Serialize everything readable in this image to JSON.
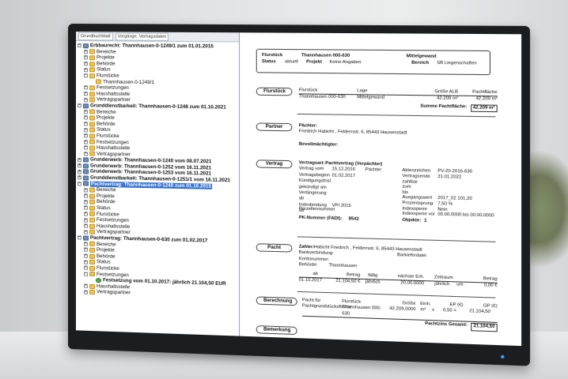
{
  "tree": {
    "toolbar": [
      "Grundbuchblatt",
      "Vorgänge, Vertragsdaten"
    ],
    "items": [
      {
        "level": 1,
        "icon": "root",
        "exp": "−",
        "bold": true,
        "label": "Erbbaurecht: Thannhausen-0-1249/1 zum 01.01.2015"
      },
      {
        "level": 2,
        "icon": "folder",
        "exp": "+",
        "label": "Bereiche"
      },
      {
        "level": 2,
        "icon": "folder",
        "exp": "+",
        "label": "Projekte"
      },
      {
        "level": 2,
        "icon": "folder",
        "exp": "+",
        "label": "Behörde"
      },
      {
        "level": 2,
        "icon": "folder",
        "exp": "+",
        "label": "Status"
      },
      {
        "level": 2,
        "icon": "folder",
        "exp": "−",
        "label": "Flurstücke"
      },
      {
        "level": 3,
        "icon": "folder",
        "exp": "",
        "label": "Thannhausen-0-1249/1"
      },
      {
        "level": 2,
        "icon": "folder",
        "exp": "+",
        "label": "Festsetzungen"
      },
      {
        "level": 2,
        "icon": "folder",
        "exp": "+",
        "label": "Haushaltsstelle"
      },
      {
        "level": 2,
        "icon": "folder",
        "exp": "+",
        "label": "Vertragspartner"
      },
      {
        "level": 1,
        "icon": "root",
        "exp": "−",
        "bold": true,
        "label": "Grunddienstbarkeit: Thannhausen-0-1248 zum 01.10.2021"
      },
      {
        "level": 2,
        "icon": "folder",
        "exp": "+",
        "label": "Bereiche"
      },
      {
        "level": 2,
        "icon": "folder",
        "exp": "+",
        "label": "Projekte"
      },
      {
        "level": 2,
        "icon": "folder",
        "exp": "+",
        "label": "Behörde"
      },
      {
        "level": 2,
        "icon": "folder",
        "exp": "+",
        "label": "Status"
      },
      {
        "level": 2,
        "icon": "folder",
        "exp": "+",
        "label": "Flurstücke"
      },
      {
        "level": 2,
        "icon": "folder",
        "exp": "+",
        "label": "Festsetzungen"
      },
      {
        "level": 2,
        "icon": "folder",
        "exp": "+",
        "label": "Haushaltsstelle"
      },
      {
        "level": 2,
        "icon": "folder",
        "exp": "+",
        "label": "Vertragspartner"
      },
      {
        "level": 1,
        "icon": "root",
        "exp": "+",
        "bold": true,
        "label": "Grunderwerb: Thannhausen-0-1240 vom 08.07.2021"
      },
      {
        "level": 1,
        "icon": "root",
        "exp": "+",
        "bold": true,
        "label": "Grunderwerb: Thannhausen-0-1252 vom 16.11.2021"
      },
      {
        "level": 1,
        "icon": "root",
        "exp": "+",
        "bold": true,
        "label": "Grunderwerb: Thannhausen-0-1253 vom 16.11.2021"
      },
      {
        "level": 1,
        "icon": "root",
        "exp": "+",
        "bold": true,
        "label": "Grunddienstbarkeit: Thannhausen-0-1251/1 vom 16.11.2021"
      },
      {
        "level": 1,
        "icon": "root",
        "exp": "−",
        "bold": true,
        "selected": true,
        "label": "Pachtvertrag: Thannhausen-0-1240 zum 01.10.2015"
      },
      {
        "level": 2,
        "icon": "folder",
        "exp": "+",
        "label": "Bereiche"
      },
      {
        "level": 2,
        "icon": "folder",
        "exp": "+",
        "label": "Projekte"
      },
      {
        "level": 2,
        "icon": "folder",
        "exp": "+",
        "label": "Behörde"
      },
      {
        "level": 2,
        "icon": "folder",
        "exp": "+",
        "label": "Status"
      },
      {
        "level": 2,
        "icon": "folder",
        "exp": "+",
        "label": "Flurstücke"
      },
      {
        "level": 2,
        "icon": "folder",
        "exp": "+",
        "label": "Festsetzungen"
      },
      {
        "level": 2,
        "icon": "folder",
        "exp": "+",
        "label": "Haushaltsstelle"
      },
      {
        "level": 2,
        "icon": "folder",
        "exp": "+",
        "label": "Vertragspartner"
      },
      {
        "level": 1,
        "icon": "root",
        "exp": "−",
        "bold": true,
        "label": "Pachtvertrag: Thannhausen-0-630 zum 01.02.2017"
      },
      {
        "level": 2,
        "icon": "folder",
        "exp": "+",
        "label": "Bereiche"
      },
      {
        "level": 2,
        "icon": "folder",
        "exp": "+",
        "label": "Projekte"
      },
      {
        "level": 2,
        "icon": "folder",
        "exp": "+",
        "label": "Behörde"
      },
      {
        "level": 2,
        "icon": "folder",
        "exp": "+",
        "label": "Status"
      },
      {
        "level": 2,
        "icon": "folder",
        "exp": "+",
        "label": "Flurstücke"
      },
      {
        "level": 2,
        "icon": "folder",
        "exp": "−",
        "label": "Festsetzungen"
      },
      {
        "level": 3,
        "icon": "green",
        "exp": "",
        "bold": true,
        "label": "Festsetzung vom 01.10.2017: jährlich 21.104,50 EUR"
      },
      {
        "level": 2,
        "icon": "folder",
        "exp": "+",
        "label": "Haushaltsstelle"
      },
      {
        "level": 2,
        "icon": "folder",
        "exp": "+",
        "label": "Vertragspartner"
      }
    ]
  },
  "header": {
    "flurstueck_label": "Flurstück",
    "flurstueck_value": "Thannhausen 000-630",
    "lage_value": "Mittelgewand",
    "status_label": "Status",
    "status_value": "aktuell",
    "projekt_label": "Projekt",
    "projekt_value": "Keine Angaben",
    "bereich_label": "Bereich",
    "bereich_value": "SB Liegenschaften"
  },
  "flurstueck": {
    "button": "Flurstück",
    "cols": [
      "Flurstück",
      "Lage",
      "Größe ALB",
      "Pachtfläche"
    ],
    "row": [
      "Thannhausen 000-630",
      "Mittelgewand",
      "42.209 m²",
      "42.209 m²"
    ],
    "sum_label": "Summe Pachtfläche:",
    "sum_value": "42.209 m²"
  },
  "partner": {
    "button": "Partner",
    "paechter_label": "Pächter:",
    "paechter_value": "Friedrich Habicht , Feldernstr. 6, 85443 Hausenstadt",
    "bevoll_label": "Bevollmächtigter:"
  },
  "vertrag": {
    "button": "Vertrag",
    "vertragsart_label": "Vertragsart:",
    "vertragsart_value": "Pachtvertrag (Verpächter)",
    "left": [
      [
        "Vertrag vom",
        "15.12.2016",
        "Pächter"
      ],
      [
        "Vertragsbeginn",
        "01.02.2017",
        ""
      ],
      [
        "Kündigungsfrist",
        "",
        ""
      ],
      [
        "gekündigt am",
        "",
        ""
      ],
      [
        "Verlängerung ab",
        "",
        ""
      ],
      [
        "Indexbindung ab",
        "VPI 2015",
        ""
      ]
    ],
    "right": [
      [
        "Aktenzeichen",
        "PV-20-2016-630"
      ],
      [
        "Vertragsende",
        "31.01.2022"
      ],
      [
        "zahlbar",
        ""
      ],
      [
        "zum",
        ""
      ],
      [
        "bis",
        ""
      ],
      [
        "Ausgangswert",
        "2017_02 101,20"
      ],
      [
        "Prozentsprung",
        "7,50 %"
      ],
      [
        "Indexsperre",
        "Nein"
      ],
      [
        "Indexsperre vor",
        "00.00.0000 bis 00.00.0000"
      ]
    ],
    "parzelle_label": "Parzellennummer",
    "pk_label": "PK-Nummer (FADI):",
    "pk_value": "8542",
    "objekte_label": "Objekte:",
    "objekte_value": "1"
  },
  "pacht": {
    "button": "Pacht",
    "zahler_label": "Zahler:",
    "zahler_value": "Habicht Friedrich , Feldernstr. 6, 85443 Hausenstadt",
    "bank_label": "Bankverbindung:",
    "bank_value": "Barkieferdatei",
    "konto_label": "Kontonummer:",
    "behoerde_label": "Behörde:",
    "behoerde_value": "Thannhausen",
    "cols": [
      "ab",
      "Betrag",
      "fällig",
      "nächste Erh.",
      "Zeitraum",
      "Betrag"
    ],
    "row": [
      "01.10.2017",
      "21.104,50 €",
      "jährlich",
      "20.00.0000",
      "jährlich",
      "um",
      "0,00 €"
    ]
  },
  "berechnung": {
    "button": "Berechnung",
    "pacht_fuer_label": "Pacht für",
    "cols": [
      "Flurstück",
      "Größe",
      "Einh.",
      "EP (€)",
      "GP (€)"
    ],
    "row_label": "Pachtgrundstücksfläche",
    "row": [
      "Thannhausen 000-630",
      "42.209,0000",
      "m²",
      "x",
      "0,50 =",
      "21.104,50"
    ],
    "total_label": "Pachtzins Gesamt:",
    "total_value": "21.104,50"
  },
  "bemerkung": {
    "button": "Bemerkung"
  }
}
